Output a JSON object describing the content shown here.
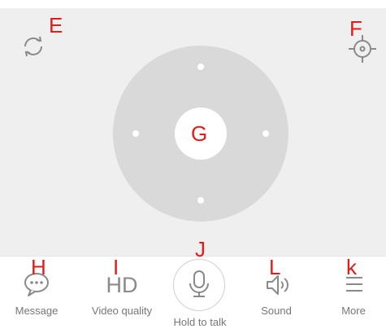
{
  "annotations": {
    "rotate": "E",
    "locate": "F",
    "center": "G",
    "message": "H",
    "video_quality": "I",
    "talk": "J",
    "sound": "L",
    "more": "k"
  },
  "controls": {
    "center_label": "G"
  },
  "toolbar": {
    "message_label": "Message",
    "hd_text": "HD",
    "video_quality_label": "Video quality",
    "talk_label": "Hold to talk",
    "sound_label": "Sound",
    "more_label": "More"
  },
  "icons": {
    "rotate": "refresh-icon",
    "locate": "crosshair-icon",
    "message": "chat-bubble-icon",
    "talk": "microphone-icon",
    "sound": "speaker-icon",
    "more": "menu-icon"
  },
  "colors": {
    "annotation": "#e21b1b",
    "icon_gray": "#8a8a8a",
    "dpad_gray": "#d9d9d9",
    "viewport_bg": "#efefef"
  }
}
